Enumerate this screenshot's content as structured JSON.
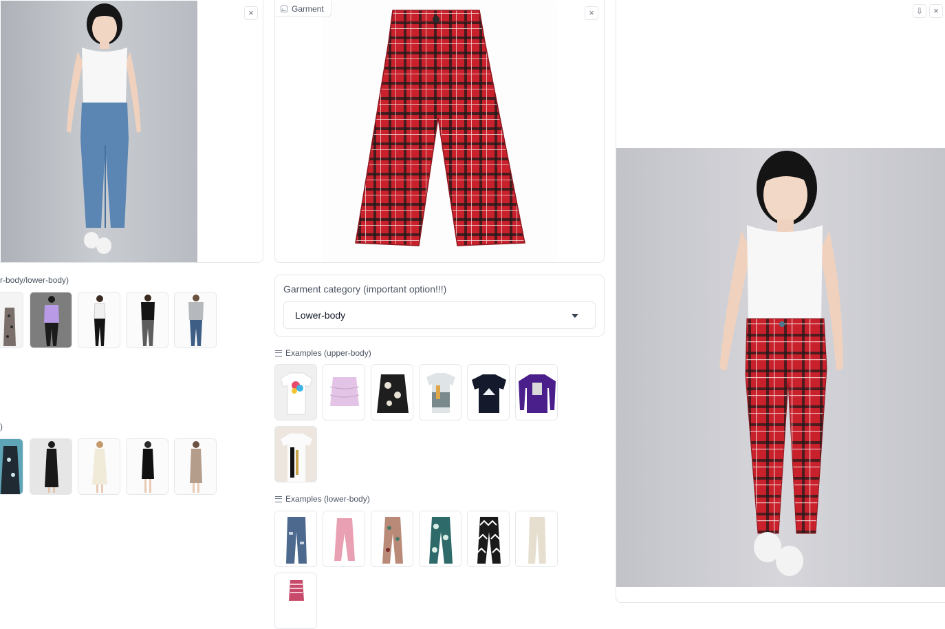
{
  "person_panel": {
    "close_label": "×"
  },
  "upper_lower_examples": {
    "label": "r-body/lower-body)"
  },
  "dresses_examples": {
    "label": ")"
  },
  "garment_panel": {
    "chip_label": "Garment",
    "close_label": "×"
  },
  "category": {
    "title": "Garment category (important option!!!)",
    "selected": "Lower-body"
  },
  "upper_examples": {
    "label": "Examples (upper-body)"
  },
  "lower_examples": {
    "label": "Examples (lower-body)"
  },
  "result_panel": {
    "download_label": "⇩",
    "close_label": "×"
  },
  "colors": {
    "accent_red": "#c8212c",
    "plaid_line": "#1a1a1a",
    "denim": "#5b85b3",
    "panel_border": "#e5e7eb"
  }
}
